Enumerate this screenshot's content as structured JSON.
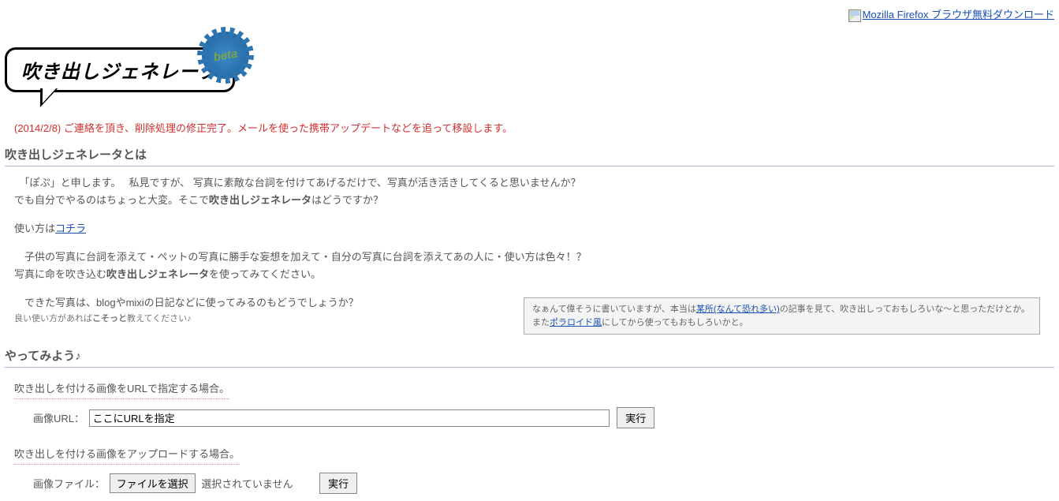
{
  "top_link": {
    "alt": "Mozilla Firefox ブラウザ無料ダウンロード"
  },
  "logo": {
    "text": "吹き出しジェネレータ",
    "badge": "beta"
  },
  "notice": "(2014/2/8) ご連絡を頂き、削除処理の修正完了。メールを使った携帯アップデートなどを追って移設します。",
  "section_about": {
    "title": "吹き出しジェネレータとは",
    "p1a": "　「ぽぷ」と申します。　 私見ですが、 写真に素敵な台詞を付けてあげるだけで、写真が活き活きしてくると思いませんか？",
    "p1b_pre": "でも自分でやるのはちょっと大変。そこで",
    "p1b_bold": "吹き出しジェネレータ",
    "p1b_post": "はどうですか？",
    "p2_pre": "使い方は",
    "p2_link": "コチラ",
    "p3a": "　子供の写真に台詞を添えて・ペットの写真に勝手な妄想を加えて・自分の写真に台詞を添えてあの人に・使い方は色々！？",
    "p3b_pre": "写真に命を吹き込む",
    "p3b_bold": "吹き出しジェネレータ",
    "p3b_post": "を使ってみてください。",
    "aside_pre": "なぁんて偉そうに書いていますが、本当は",
    "aside_link1": "某所(なんて恐れ多い)",
    "aside_mid": "の記事を見て、吹き出しっておもしろいな～と思っただけとか。 また",
    "aside_link2": "ポラロイド風",
    "aside_post": "にしてから使ってもおもしろいかと。",
    "p4": "　できた写真は、blogやmixiの日記などに使ってみるのもどうでしょうか？",
    "p4_small_pre": "良い使い方があれば",
    "p4_small_bold": "こそっと",
    "p4_small_post": "教えてください♪"
  },
  "section_try": {
    "title": "やってみよう♪",
    "sub1": "吹き出しを付ける画像をURLで指定する場合。",
    "url_label": "画像URL：",
    "url_value": "ここにURLを指定",
    "run_label": "実行",
    "sub2": "吹き出しを付ける画像をアップロードする場合。",
    "file_label": "画像ファイル：",
    "file_btn": "ファイルを選択",
    "file_status": "選択されていません"
  }
}
